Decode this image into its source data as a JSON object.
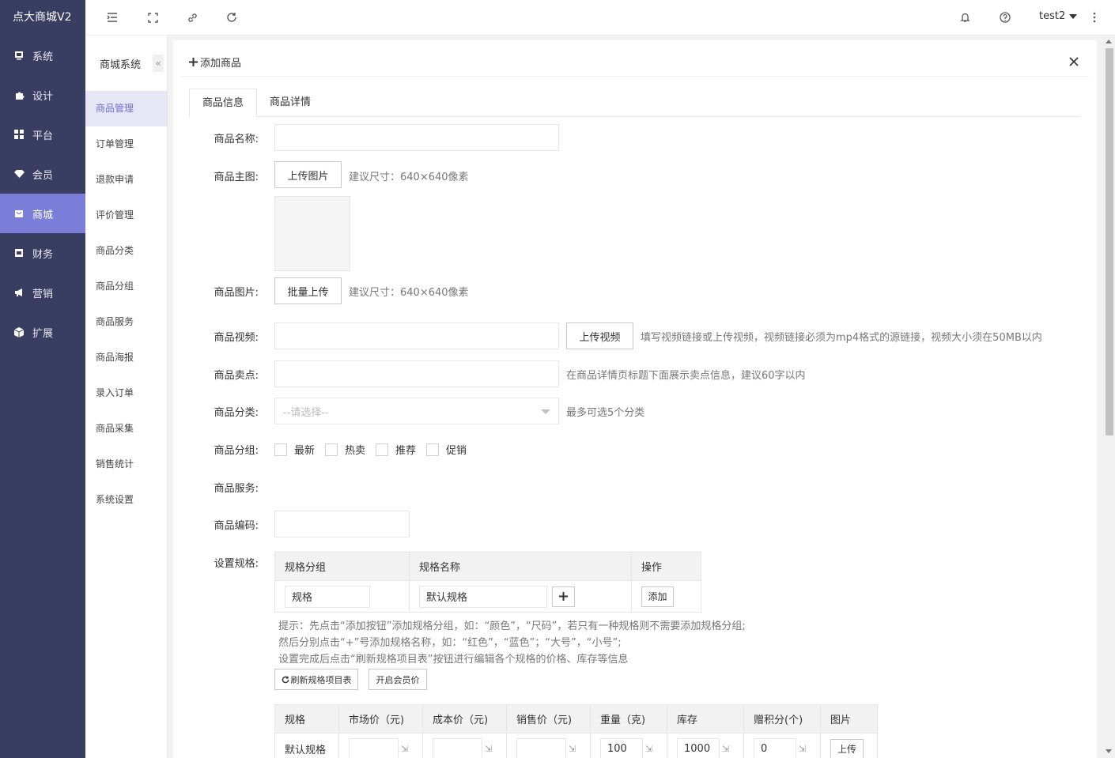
{
  "app": {
    "brand": "点大商城V2"
  },
  "sidebar": {
    "items": [
      {
        "label": "系统",
        "icon": "monitor-icon"
      },
      {
        "label": "设计",
        "icon": "puzzle-icon"
      },
      {
        "label": "平台",
        "icon": "grid-icon"
      },
      {
        "label": "会员",
        "icon": "diamond-icon"
      },
      {
        "label": "商城",
        "icon": "shop-icon",
        "active": true
      },
      {
        "label": "财务",
        "icon": "wallet-icon"
      },
      {
        "label": "营销",
        "icon": "megaphone-icon"
      },
      {
        "label": "扩展",
        "icon": "cube-icon"
      }
    ]
  },
  "topbar": {
    "user": "test2"
  },
  "submenu": {
    "title": "商城系统",
    "collapse": "«",
    "items": [
      "商品管理",
      "订单管理",
      "退款申请",
      "评价管理",
      "商品分类",
      "商品分组",
      "商品服务",
      "商品海报",
      "录入订单",
      "商品采集",
      "销售统计",
      "系统设置"
    ]
  },
  "panel": {
    "title": "添加商品",
    "tabs": [
      "商品信息",
      "商品详情"
    ],
    "form": {
      "name_label": "商品名称:",
      "main_image_label": "商品主图:",
      "upload_image_btn": "上传图片",
      "main_image_hint": "建议尺寸：640×640像素",
      "images_label": "商品图片:",
      "batch_upload_btn": "批量上传",
      "images_hint": "建议尺寸：640×640像素",
      "video_label": "商品视频:",
      "upload_video_btn": "上传视频",
      "video_hint": "填写视频链接或上传视频，视频链接必须为mp4格式的源链接，视频大小须在50MB以内",
      "selling_label": "商品卖点:",
      "selling_hint": "在商品详情页标题下面展示卖点信息，建议60字以内",
      "category_label": "商品分类:",
      "category_placeholder": "--请选择--",
      "category_hint": "最多可选5个分类",
      "group_label": "商品分组:",
      "groups": [
        "最新",
        "热卖",
        "推荐",
        "促销"
      ],
      "service_label": "商品服务:",
      "code_label": "商品编码:",
      "spec_label": "设置规格:"
    },
    "spec_table": {
      "headers": [
        "规格分组",
        "规格名称",
        "操作"
      ],
      "group_value": "规格",
      "name_value": "默认规格",
      "add_btn": "添加"
    },
    "tips": [
      "提示：先点击“添加按钮”添加规格分组，如：“颜色”，“尺码”，若只有一种规格则不需要添加规格分组;",
      "然后分别点击“+”号添加规格名称，如：“红色”，“蓝色”；“大号”，“小号”;",
      "设置完成后点击“刷新规格项目表”按钮进行编辑各个规格的价格、库存等信息"
    ],
    "refresh_btn": "刷新规格项目表",
    "member_price_btn": "开启会员价",
    "sku_table": {
      "headers": [
        "规格",
        "市场价（元)",
        "成本价（元)",
        "销售价（元)",
        "重量（克)",
        "库存",
        "赠积分(个)",
        "图片"
      ],
      "row": {
        "spec": "默认规格",
        "weight": "100",
        "stock": "1000",
        "points": "0",
        "upload": "上传"
      }
    }
  }
}
